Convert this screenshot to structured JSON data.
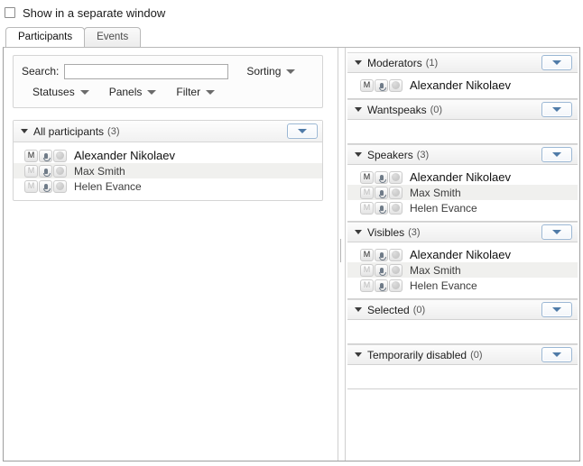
{
  "topbar": {
    "checkbox_label": "Show in a separate window",
    "checkbox_checked": false
  },
  "tabs": [
    {
      "label": "Participants",
      "active": true
    },
    {
      "label": "Events",
      "active": false
    }
  ],
  "left_pane": {
    "toolbar": {
      "search_label": "Search:",
      "search_value": "",
      "search_placeholder": "",
      "sorting_label": "Sorting",
      "statuses_label": "Statuses",
      "panels_label": "Panels",
      "filter_label": "Filter"
    },
    "group": {
      "title": "All participants",
      "count": "(3)",
      "dropdown_icon": "chevron-down-icon",
      "collapse_icon": "triangle-down-icon",
      "rows": [
        {
          "moderator": "M",
          "mic_icon": "microphone-icon",
          "cam_icon": "camera-icon",
          "name": "Alexander Nikolaev",
          "is_moderator": true,
          "highlighted": false
        },
        {
          "moderator": "M",
          "mic_icon": "microphone-icon",
          "cam_icon": "camera-icon",
          "name": "Max Smith",
          "is_moderator": false,
          "highlighted": true
        },
        {
          "moderator": "M",
          "mic_icon": "microphone-icon",
          "cam_icon": "camera-icon",
          "name": "Helen Evance",
          "is_moderator": false,
          "highlighted": false
        }
      ]
    }
  },
  "right_pane": {
    "sections": [
      {
        "title": "Moderators",
        "count": "(1)",
        "rows": [
          {
            "moderator": "M",
            "name": "Alexander Nikolaev",
            "is_moderator": true,
            "highlighted": false
          }
        ]
      },
      {
        "title": "Wantspeaks",
        "count": "(0)",
        "rows": []
      },
      {
        "title": "Speakers",
        "count": "(3)",
        "rows": [
          {
            "moderator": "M",
            "name": "Alexander Nikolaev",
            "is_moderator": true,
            "highlighted": false
          },
          {
            "moderator": "M",
            "name": "Max Smith",
            "is_moderator": false,
            "highlighted": true
          },
          {
            "moderator": "M",
            "name": "Helen Evance",
            "is_moderator": false,
            "highlighted": false
          }
        ]
      },
      {
        "title": "Visibles",
        "count": "(3)",
        "rows": [
          {
            "moderator": "M",
            "name": "Alexander Nikolaev",
            "is_moderator": true,
            "highlighted": false
          },
          {
            "moderator": "M",
            "name": "Max Smith",
            "is_moderator": false,
            "highlighted": true
          },
          {
            "moderator": "M",
            "name": "Helen Evance",
            "is_moderator": false,
            "highlighted": false
          }
        ]
      },
      {
        "title": "Selected",
        "count": "(0)",
        "rows": []
      },
      {
        "title": "Temporarily disabled",
        "count": "(0)",
        "rows": []
      }
    ]
  },
  "colors": {
    "accent_border": "#9bb7d4",
    "accent_caret": "#4f7ba8",
    "row_highlight": "#f0f0ee",
    "panel_border": "#d5d5d5",
    "window_border": "#9e9e9e"
  }
}
